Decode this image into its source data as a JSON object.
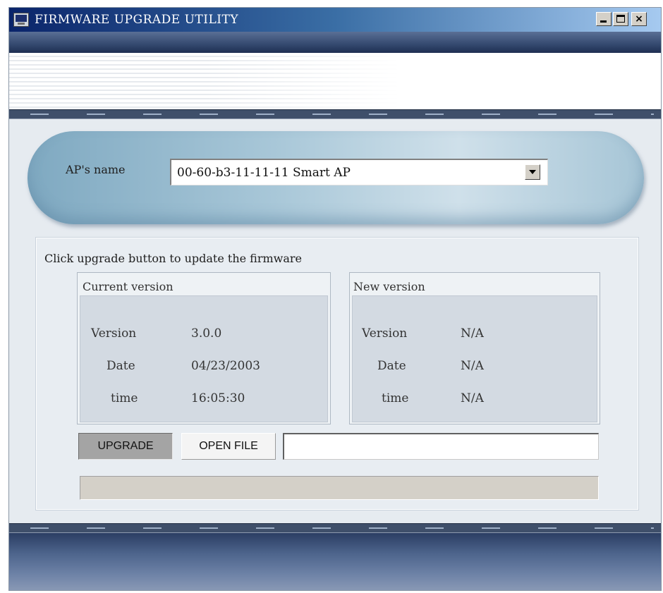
{
  "window": {
    "title": "FIRMWARE UPGRADE UTILITY",
    "icon": "app-icon",
    "controls": [
      "minimize-icon",
      "maximize-icon",
      "close-icon"
    ],
    "close_label": "×"
  },
  "ap": {
    "label": "AP's name",
    "selected": "00-60-b3-11-11-11  Smart AP"
  },
  "panel": {
    "title": "Click upgrade button to update the firmware",
    "current": {
      "heading": "Current version",
      "rows": [
        {
          "label": "Version",
          "value": "3.0.0"
        },
        {
          "label": "Date",
          "value": "04/23/2003"
        },
        {
          "label": "time",
          "value": "16:05:30"
        }
      ]
    },
    "new": {
      "heading": "New version",
      "rows": [
        {
          "label": "Version",
          "value": "N/A"
        },
        {
          "label": "Date",
          "value": "N/A"
        },
        {
          "label": "time",
          "value": "N/A"
        }
      ]
    }
  },
  "actions": {
    "upgrade_label": "UPGRADE",
    "open_file_label": "OPEN FILE",
    "file_path": ""
  },
  "progress": {
    "value": 0
  },
  "colors": {
    "title_gradient_start": "#0a246a",
    "title_gradient_end": "#a6caf0",
    "pill_blue": "#a8c7d8",
    "panel_bg": "#e8edf2"
  }
}
